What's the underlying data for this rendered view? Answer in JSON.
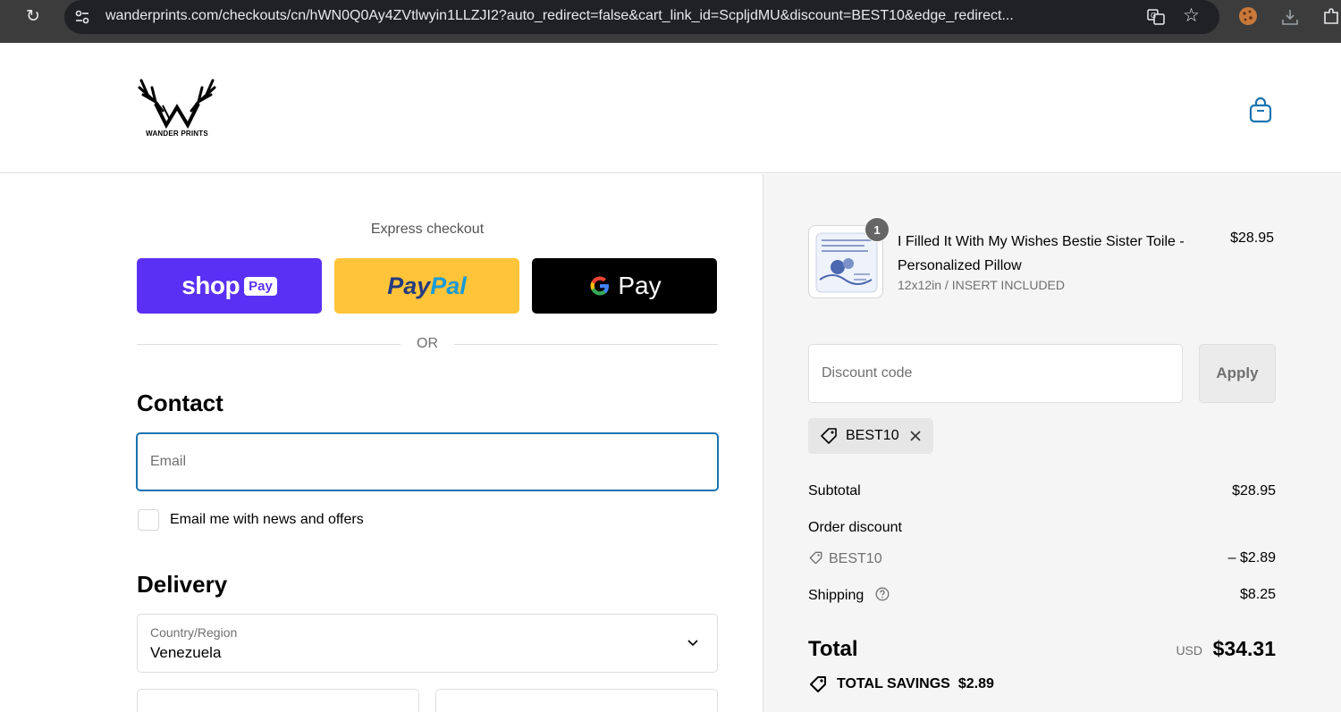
{
  "browser": {
    "url": "wanderprints.com/checkouts/cn/hWN0Q0Ay4ZVtlwyin1LLZJI2?auto_redirect=false&cart_link_id=ScpljdMU&discount=BEST10&edge_redirect..."
  },
  "store": {
    "brand": "WANDER PRINTS"
  },
  "express": {
    "title": "Express checkout",
    "shop_pay_word": "shop",
    "shop_pay_pill": "Pay",
    "paypal_part1": "Pay",
    "paypal_part2": "Pal",
    "gpay_g": "G",
    "gpay_word": "Pay",
    "or_text": "OR"
  },
  "contact": {
    "title": "Contact",
    "email_placeholder": "Email",
    "newsletter_label": "Email me with news and offers"
  },
  "delivery": {
    "title": "Delivery",
    "country_label": "Country/Region",
    "country_value": "Venezuela"
  },
  "order": {
    "product": {
      "quantity": "1",
      "title": "I Filled It With My Wishes Bestie Sister Toile - Personalized Pillow",
      "variant": "12x12in / INSERT INCLUDED",
      "price": "$28.95"
    },
    "discount_placeholder": "Discount code",
    "apply_label": "Apply",
    "applied_code": "BEST10",
    "subtotal_label": "Subtotal",
    "subtotal_value": "$28.95",
    "order_discount_label": "Order discount",
    "discount_code": "BEST10",
    "discount_value": "– $2.89",
    "shipping_label": "Shipping",
    "shipping_value": "$8.25",
    "total_label": "Total",
    "currency": "USD",
    "total_value": "$34.31",
    "savings_label": "TOTAL SAVINGS",
    "savings_value": "$2.89"
  },
  "colors": {
    "shop_pay": "#5a31f4",
    "paypal": "#ffc439",
    "focus_blue": "#1773b0"
  }
}
